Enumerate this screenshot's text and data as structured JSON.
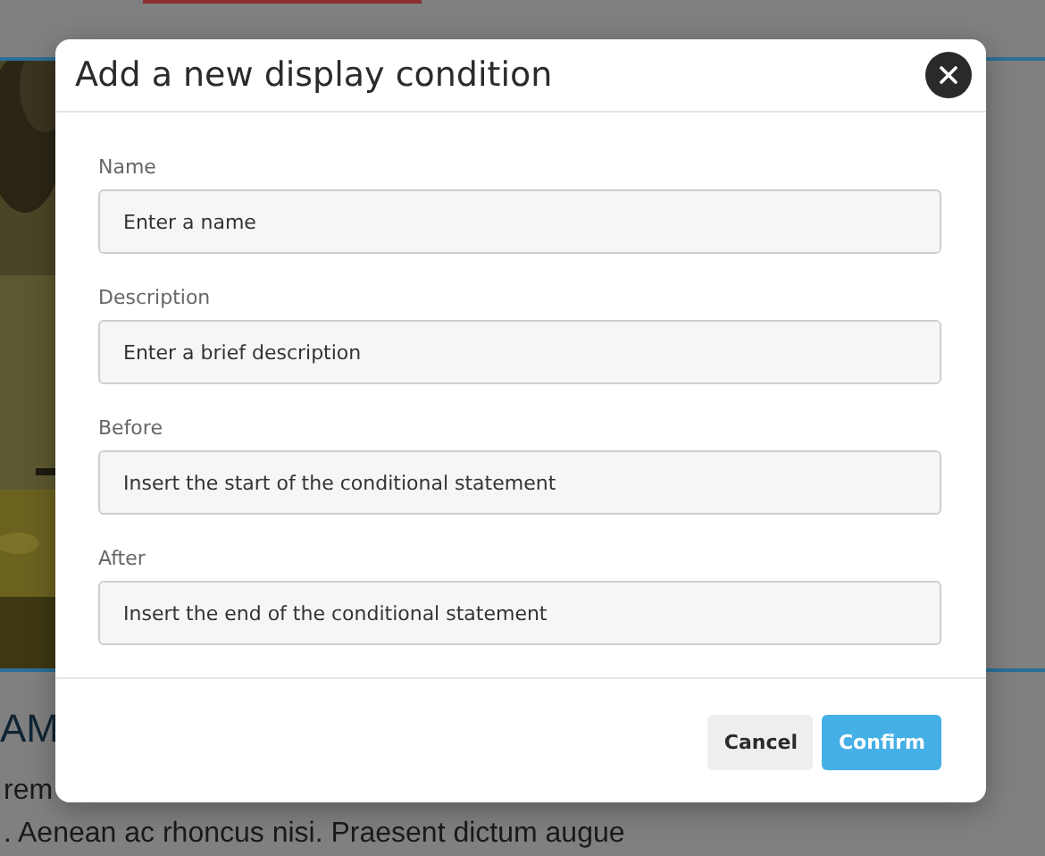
{
  "background_page": {
    "heading": "AM",
    "paragraphs": [
      "rem",
      ". Aenean ac rhoncus nisi. Praesent dictum augue"
    ]
  },
  "dialog": {
    "title": "Add a new display condition",
    "fields": [
      {
        "label": "Name",
        "placeholder": "Enter a name"
      },
      {
        "label": "Description",
        "placeholder": "Enter a brief description"
      },
      {
        "label": "Before",
        "placeholder": "Insert the start of the conditional statement"
      },
      {
        "label": "After",
        "placeholder": "Insert the end of the conditional statement"
      }
    ],
    "buttons": [
      {
        "label": "Cancel",
        "kind": "secondary"
      },
      {
        "label": "Confirm",
        "kind": "primary"
      }
    ]
  }
}
